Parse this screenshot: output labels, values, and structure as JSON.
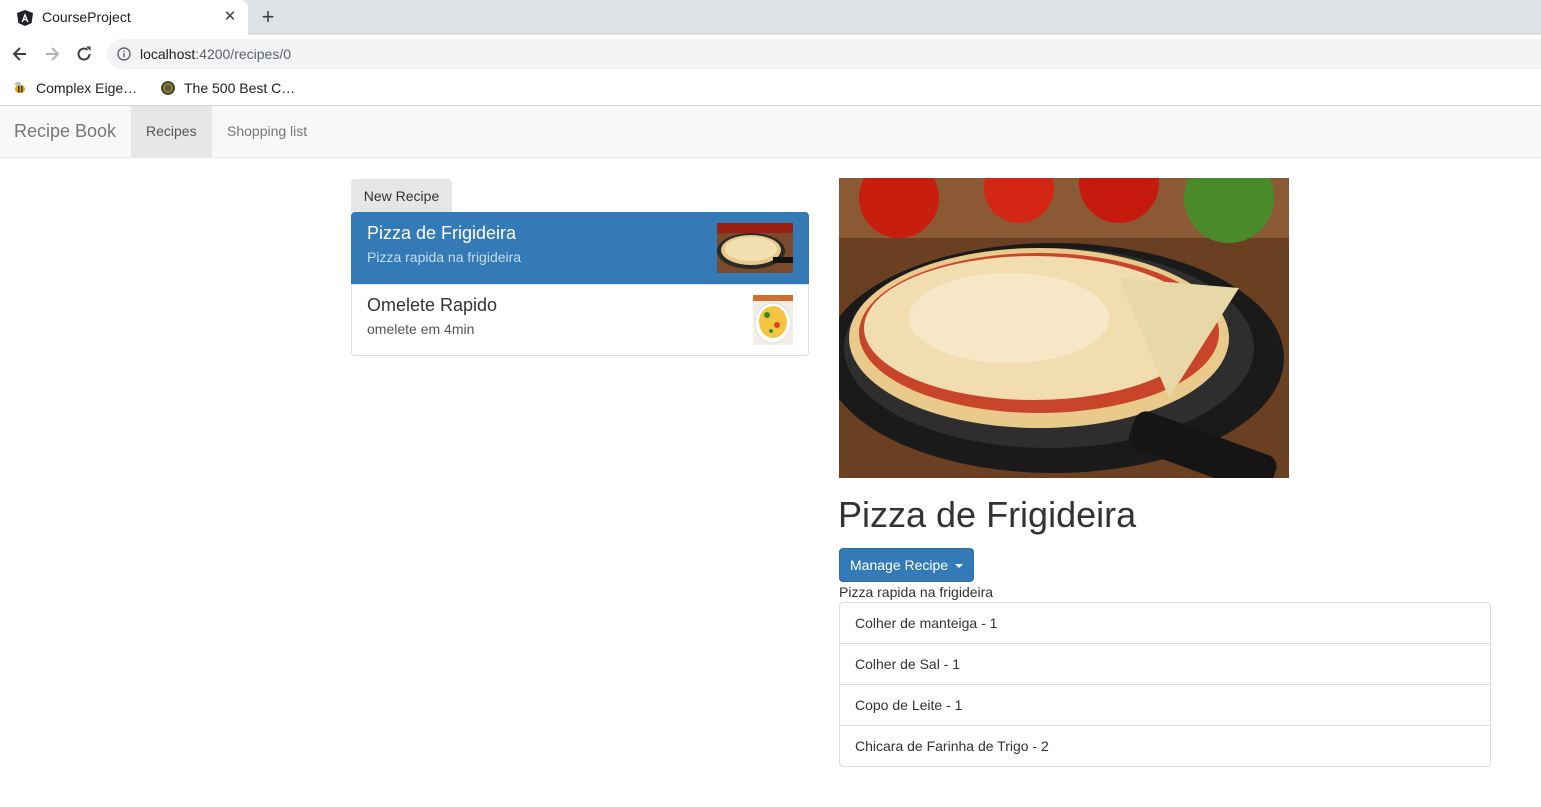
{
  "browser": {
    "tab_title": "CourseProject",
    "url_host": "localhost",
    "url_path": ":4200/recipes/0",
    "bookmarks": [
      {
        "label": "Complex Eige…"
      },
      {
        "label": "The 500 Best C…"
      }
    ]
  },
  "navbar": {
    "brand": "Recipe Book",
    "links": [
      {
        "label": "Recipes",
        "active": true
      },
      {
        "label": "Shopping list",
        "active": false
      }
    ]
  },
  "recipes": {
    "new_button": "New Recipe",
    "items": [
      {
        "name": "Pizza de Frigideira",
        "description": "Pizza rapida na frigideira",
        "active": true
      },
      {
        "name": "Omelete Rapido",
        "description": "omelete em 4min",
        "active": false
      }
    ]
  },
  "detail": {
    "title": "Pizza de Frigideira",
    "manage_button": "Manage Recipe",
    "description": "Pizza rapida na frigideira",
    "ingredients": [
      "Colher de manteiga - 1",
      "Colher de Sal - 1",
      "Copo de Leite - 1",
      "Chicara de Farinha de Trigo - 2"
    ]
  },
  "colors": {
    "primary": "#337ab7",
    "navbar_bg": "#f8f8f8"
  }
}
